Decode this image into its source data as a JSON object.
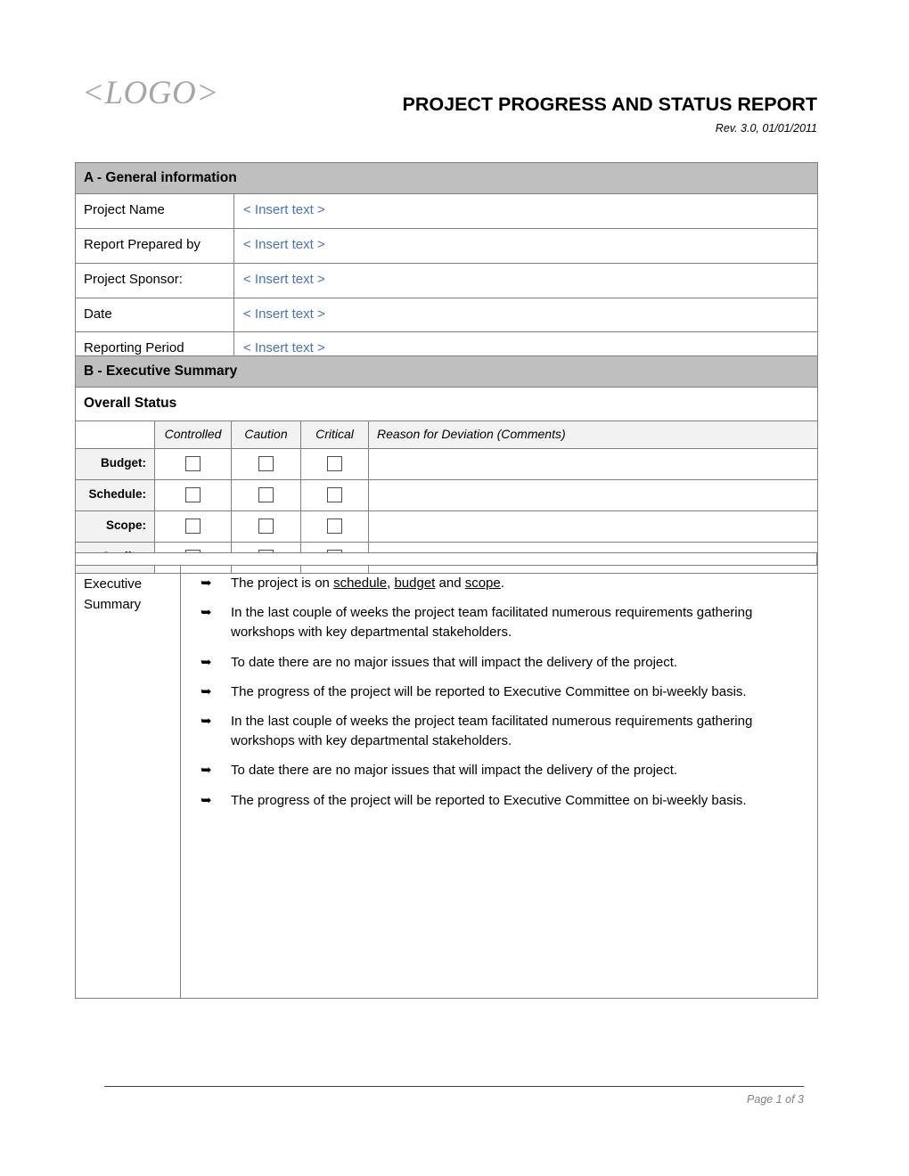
{
  "header": {
    "logo": "<LOGO>",
    "title": "PROJECT PROGRESS AND STATUS REPORT",
    "revision": "Rev. 3.0, 01/01/2011"
  },
  "section_a": {
    "banner": "A - General information",
    "rows": [
      {
        "label": "Project Name",
        "value": "< Insert text >"
      },
      {
        "label": "Report Prepared by",
        "value": "< Insert text >"
      },
      {
        "label": "Project Sponsor:",
        "value": "< Insert text >"
      },
      {
        "label": "Date",
        "value": "< Insert text >"
      },
      {
        "label": "Reporting Period",
        "value": "< Insert text >"
      }
    ]
  },
  "section_b": {
    "banner": "B - Executive Summary",
    "overall_status": "Overall Status",
    "status_table": {
      "columns": [
        "",
        "Controlled",
        "Caution",
        "Critical",
        "Reason for Deviation (Comments)"
      ],
      "rows": [
        {
          "label": "Budget:",
          "controlled": false,
          "caution": false,
          "critical": false,
          "reason": ""
        },
        {
          "label": "Schedule:",
          "controlled": false,
          "caution": false,
          "critical": false,
          "reason": ""
        },
        {
          "label": "Scope:",
          "controlled": false,
          "caution": false,
          "critical": false,
          "reason": ""
        },
        {
          "label": "Quality:",
          "controlled": false,
          "caution": false,
          "critical": false,
          "reason": ""
        }
      ]
    },
    "executive_summary": {
      "label": "Executive Summary",
      "bullet_marker": "arrowhead-bullet",
      "bullets": [
        {
          "prefix": "The project is on ",
          "u1": "schedule",
          "mid1": ", ",
          "u2": "budget",
          "mid2": " and ",
          "u3": "scope",
          "suffix": "."
        },
        {
          "text": "In the last couple of weeks the project team facilitated numerous requirements gathering workshops with key departmental stakeholders."
        },
        {
          "text": "To date there are no major issues that will impact the delivery of the project."
        },
        {
          "text": "The progress of the project will be reported to Executive Committee on bi-weekly basis."
        },
        {
          "text": "In the last couple of weeks the project team facilitated numerous requirements gathering workshops with key departmental stakeholders."
        },
        {
          "text": "To date there are no major issues that will impact the delivery of the project."
        },
        {
          "text": "The progress of the project will be reported to Executive Committee on bi-weekly basis."
        }
      ]
    }
  },
  "footer": {
    "page_label": "Page 1 of 3"
  },
  "colors": {
    "section_banner": "#bfbfbf",
    "subhead_fill": "#f2f2f2",
    "placeholder_text": "#4472c4",
    "border": "#7f7f7f",
    "logo_text": "#a6a6a6",
    "footer_text": "#808080"
  }
}
